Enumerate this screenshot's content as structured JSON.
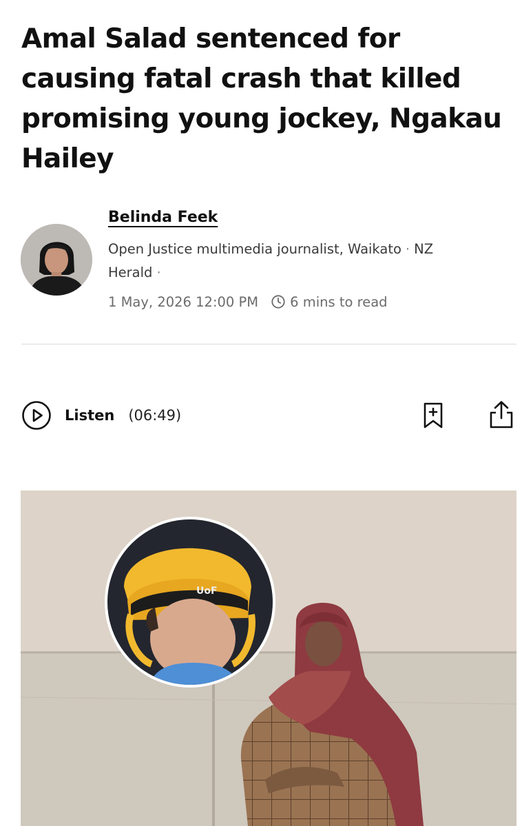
{
  "article": {
    "headline": "Amal Salad sentenced for causing fatal crash that killed promising young jockey, Ngakau Hailey"
  },
  "author": {
    "name": "Belinda Feek",
    "role_prefix": "Open Justice multimedia journalist, Waikato",
    "outlet": "NZ Herald",
    "separator": "·",
    "avatar_icon": "author-avatar-photo"
  },
  "meta": {
    "date": "1 May, 2026 12:00 PM",
    "read_time": "6 mins to read",
    "read_time_icon": "clock-icon"
  },
  "listen": {
    "label": "Listen",
    "duration": "(06:49)",
    "icon": "play-icon"
  },
  "actions": {
    "bookmark_icon": "bookmark-add-icon",
    "share_icon": "share-icon"
  },
  "hero_image": {
    "inset_icon": "jockey-portrait-inset",
    "badge_text": "UoF"
  },
  "colors": {
    "text": "#111111",
    "muted": "#6b6b6b",
    "divider": "#dcdcdc"
  }
}
